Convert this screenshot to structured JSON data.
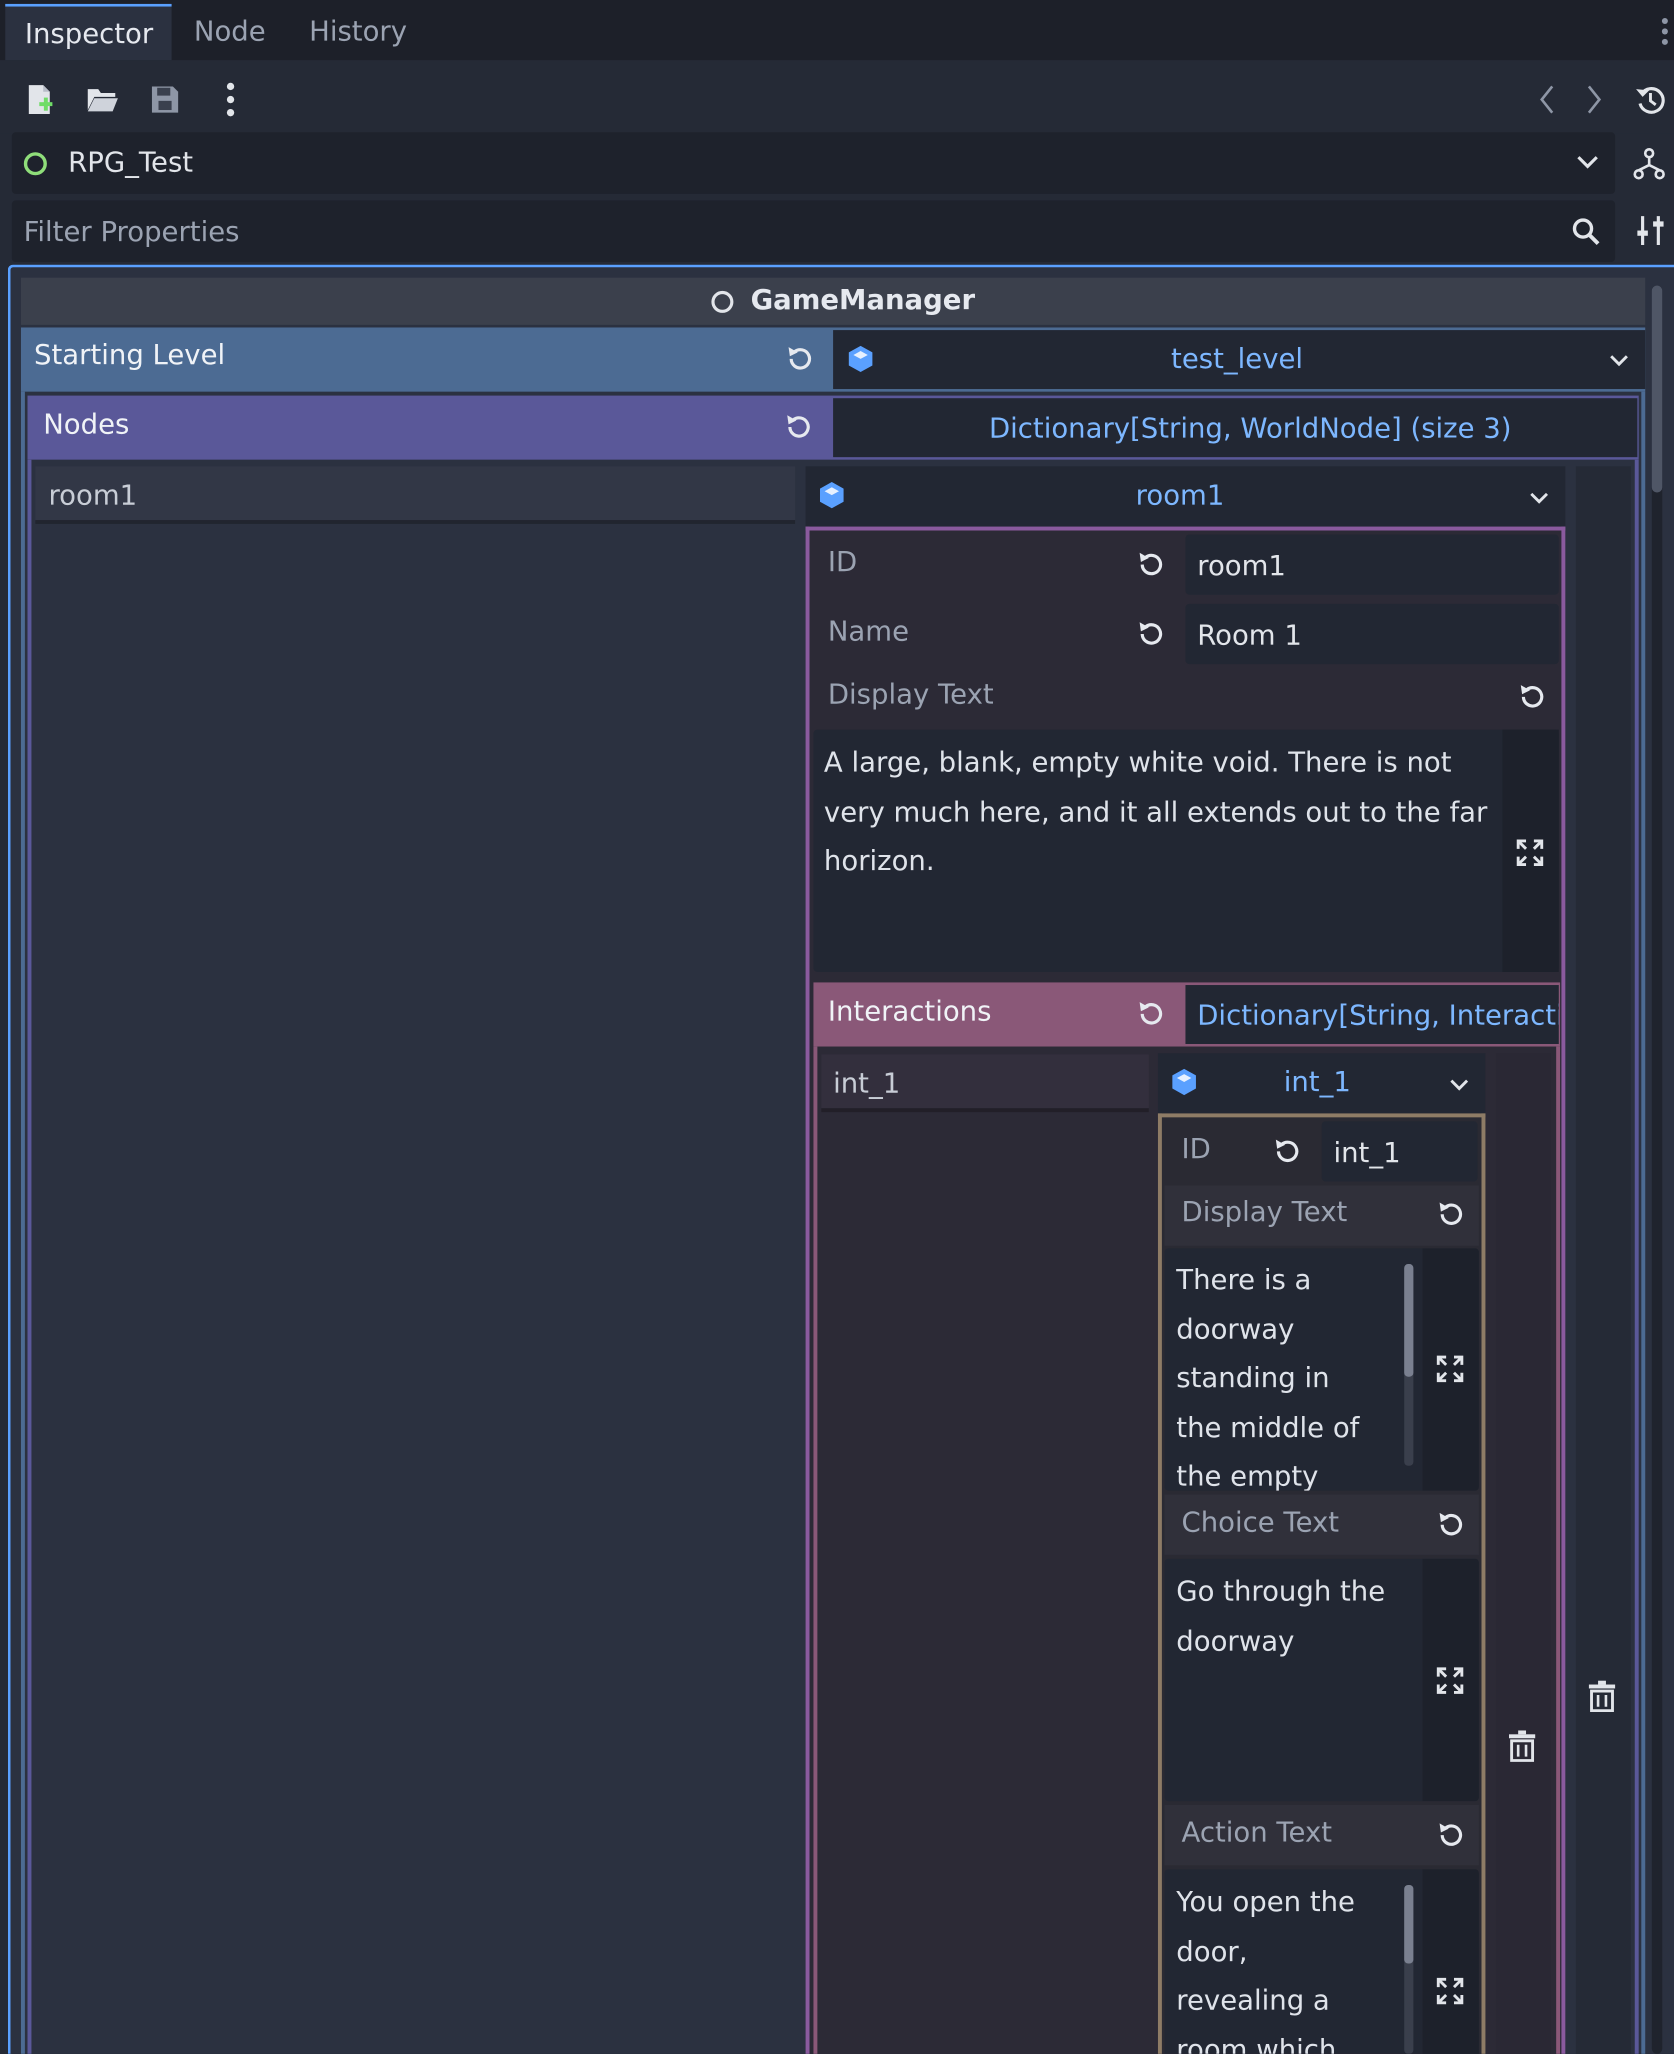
{
  "tabs": [
    "Inspector",
    "Node",
    "History"
  ],
  "active_tab": "Inspector",
  "resource": {
    "name": "RPG_Test"
  },
  "filter": {
    "placeholder": "Filter Properties"
  },
  "class_header": "GameManager",
  "starting_level": {
    "label": "Starting Level",
    "value": "test_level"
  },
  "nodes": {
    "label": "Nodes",
    "value": "Dictionary[String, WorldNode] (size 3)",
    "key": "room1",
    "item": "room1",
    "id": {
      "label": "ID",
      "value": "room1"
    },
    "name": {
      "label": "Name",
      "value": "Room 1"
    },
    "display_text": {
      "label": "Display Text",
      "lines": [
        "A large, blank, empty white void. There is not",
        "very much here, and it all extends out to the far",
        "horizon."
      ]
    },
    "interactions": {
      "label": "Interactions",
      "value": "Dictionary[String, Interacti",
      "key": "int_1",
      "item": "int_1",
      "id": {
        "label": "ID",
        "value": "int_1"
      },
      "display_text": {
        "label": "Display Text",
        "lines": [
          "There is a",
          "doorway",
          "standing in",
          "the middle of",
          "the empty"
        ]
      },
      "choice_text": {
        "label": "Choice Text",
        "lines": [
          "Go through the",
          "doorway"
        ]
      },
      "action_text": {
        "label": "Action Text",
        "lines": [
          "You open the",
          "door,",
          "revealing a",
          "room which"
        ]
      }
    }
  },
  "colors": {
    "accent": "#5aa0ff",
    "starting_level_row": "#4c6b93",
    "nodes_row": "#5a5899",
    "interactions_row": "#8a5878",
    "node_border": "#8a5a9e",
    "interaction_border": "#8e7c66",
    "ok_circle": "#8fde7a"
  }
}
